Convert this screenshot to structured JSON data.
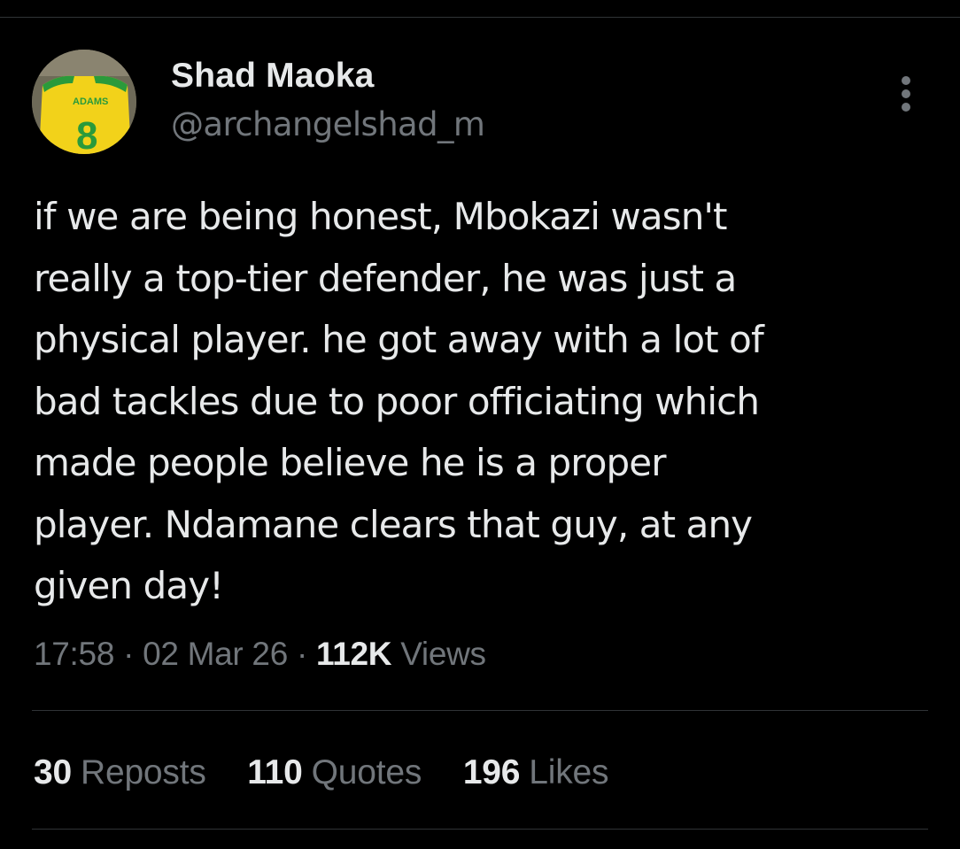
{
  "author": {
    "display_name": "Shad Maoka",
    "handle": "@archangelshad_m",
    "avatar": {
      "shirt_name": "ADAMS",
      "shirt_number": "8",
      "colors": {
        "shirt": "#f2d21a",
        "trim": "#2a9a3b",
        "background": "#6e6a58"
      }
    }
  },
  "tweet": {
    "text": "if we are being honest, Mbokazi wasn't\nreally a top-tier defender, he was just a\nphysical player. he got away with a lot of\nbad tackles due to poor officiating which\nmade people believe he is a proper\nplayer. Ndamane clears that guy, at any\ngiven day!"
  },
  "meta": {
    "time": "17:58",
    "separator": "·",
    "date": "02 Mar 26",
    "views_count": "112K",
    "views_label": "Views"
  },
  "stats": {
    "reposts": {
      "count": "30",
      "label": "Reposts"
    },
    "quotes": {
      "count": "110",
      "label": "Quotes"
    },
    "likes": {
      "count": "196",
      "label": "Likes"
    }
  },
  "icons": {
    "more": "more-vertical-icon"
  },
  "colors": {
    "background": "#000000",
    "primary_text": "#e7e9ea",
    "secondary_text": "#71767b",
    "divider": "#2f3336"
  }
}
